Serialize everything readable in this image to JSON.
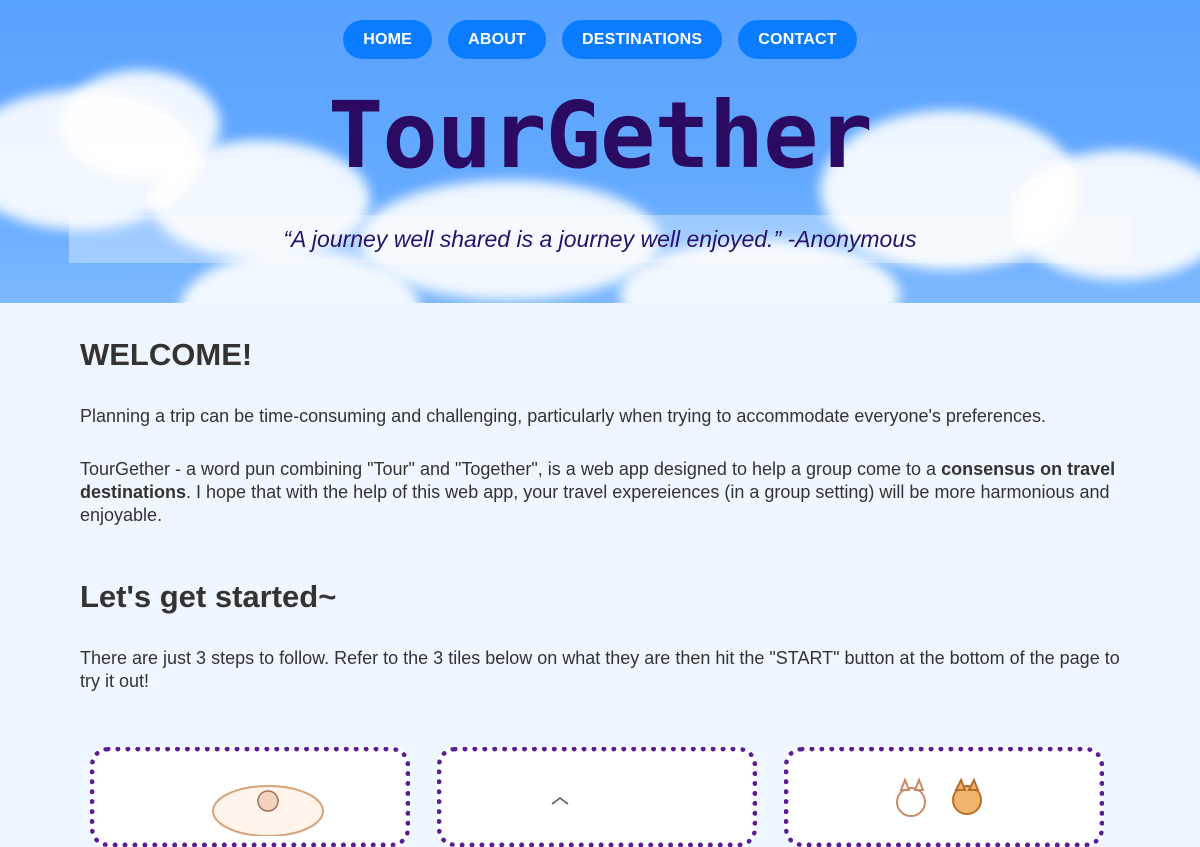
{
  "nav": {
    "items": [
      "HOME",
      "ABOUT",
      "DESTINATIONS",
      "CONTACT"
    ]
  },
  "hero": {
    "brand": "TourGether",
    "quote": "“A journey well shared is a journey well enjoyed.” -Anonymous"
  },
  "welcome": {
    "heading": "WELCOME!",
    "p1": "Planning a trip can be time-consuming and challenging, particularly when trying to accommodate everyone's preferences.",
    "p2_start": "TourGether - a word pun combining \"Tour\" and \"Together\", is a web app designed to help a group come to a ",
    "p2_bold": "consensus on travel destinations",
    "p2_end": ". I hope that with the help of this web app, your travel expereiences (in a group setting) will be more harmonious and enjoyable."
  },
  "started": {
    "heading": "Let's get started~",
    "p": "There are just 3 steps to follow. Refer to the 3 tiles below on what they are then hit the \"START\" button at the bottom of the page to try it out!"
  },
  "colors": {
    "sky": "#5aa2ff",
    "nav_button": "#0a7cff",
    "brand": "#2a0b61",
    "tile_border": "#5a1d96",
    "page_bg": "#eef6ff"
  }
}
